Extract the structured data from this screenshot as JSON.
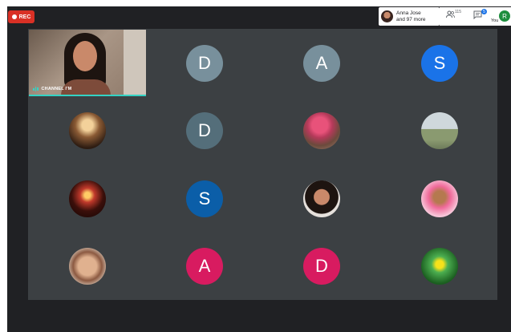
{
  "recording": {
    "label": "REC",
    "color": "#d93025"
  },
  "participants_chip": {
    "line1": "Anna Jose",
    "line2": "and 97 more"
  },
  "controls": {
    "people_icon": "people-icon",
    "people_count": "115",
    "chat_icon": "chat-icon",
    "chat_badge": "5",
    "you_label": "You",
    "self_initial": "R",
    "self_color": "#1e8e3e"
  },
  "presenter_tile": {
    "label": "CHANNEL I'M",
    "accent": "#34d3c4"
  },
  "tiles": [
    {
      "row": 0,
      "col": 1,
      "kind": "letter",
      "initial": "D",
      "color": "#78909c"
    },
    {
      "row": 0,
      "col": 2,
      "kind": "letter",
      "initial": "A",
      "color": "#78909c"
    },
    {
      "row": 0,
      "col": 3,
      "kind": "letter",
      "initial": "S",
      "color": "#1a73e8"
    },
    {
      "row": 1,
      "col": 0,
      "kind": "photo",
      "icon": "room-photo"
    },
    {
      "row": 1,
      "col": 1,
      "kind": "letter",
      "initial": "D",
      "color": "#546e7a"
    },
    {
      "row": 1,
      "col": 2,
      "kind": "photo",
      "icon": "flowers-photo"
    },
    {
      "row": 1,
      "col": 3,
      "kind": "photo",
      "icon": "landscape-photo"
    },
    {
      "row": 2,
      "col": 0,
      "kind": "photo",
      "icon": "candle-photo"
    },
    {
      "row": 2,
      "col": 1,
      "kind": "letter",
      "initial": "S",
      "color": "#0b5ea8"
    },
    {
      "row": 2,
      "col": 2,
      "kind": "photo",
      "icon": "girl-portrait-photo"
    },
    {
      "row": 2,
      "col": 3,
      "kind": "photo",
      "icon": "jesus-heart-photo"
    },
    {
      "row": 3,
      "col": 0,
      "kind": "photo",
      "icon": "hands-photo"
    },
    {
      "row": 3,
      "col": 1,
      "kind": "letter",
      "initial": "A",
      "color": "#d81b60"
    },
    {
      "row": 3,
      "col": 2,
      "kind": "letter",
      "initial": "D",
      "color": "#d81b60"
    },
    {
      "row": 3,
      "col": 3,
      "kind": "photo",
      "icon": "yellow-flower-photo"
    }
  ]
}
